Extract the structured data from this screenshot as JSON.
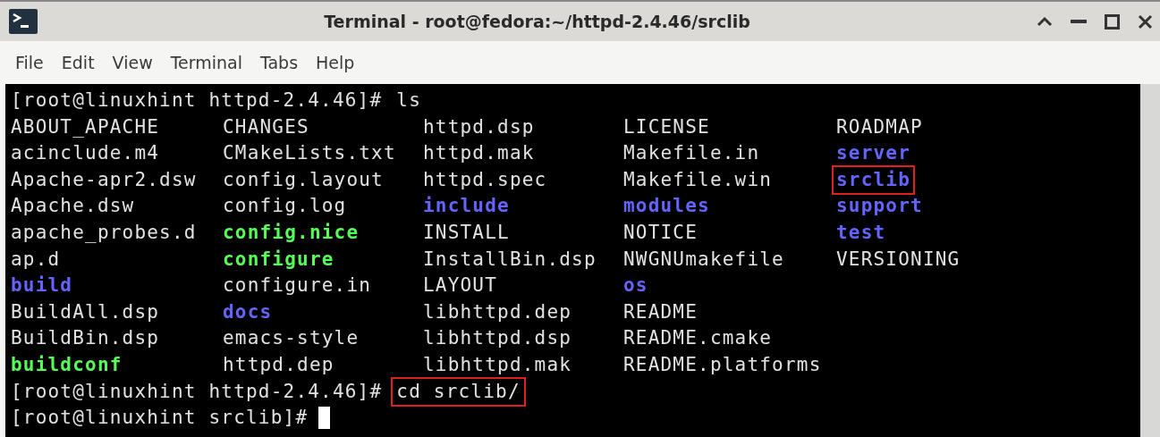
{
  "window": {
    "title": "Terminal - root@fedora:~/httpd-2.4.46/srclib"
  },
  "menu": [
    "File",
    "Edit",
    "View",
    "Terminal",
    "Tabs",
    "Help"
  ],
  "terminal": [
    {
      "kind": "prompt",
      "prompt": "[root@linuxhint httpd-2.4.46]#",
      "command": "ls",
      "highlighted": false
    },
    {
      "kind": "listing",
      "rows": [
        [
          {
            "name": "ABOUT_APACHE",
            "kind": "file",
            "highlighted": false
          },
          {
            "name": "CHANGES",
            "kind": "file",
            "highlighted": false
          },
          {
            "name": "httpd.dsp",
            "kind": "file",
            "highlighted": false
          },
          {
            "name": "LICENSE",
            "kind": "file",
            "highlighted": false
          },
          {
            "name": "ROADMAP",
            "kind": "file",
            "highlighted": false
          }
        ],
        [
          {
            "name": "acinclude.m4",
            "kind": "file",
            "highlighted": false
          },
          {
            "name": "CMakeLists.txt",
            "kind": "file",
            "highlighted": false
          },
          {
            "name": "httpd.mak",
            "kind": "file",
            "highlighted": false
          },
          {
            "name": "Makefile.in",
            "kind": "file",
            "highlighted": false
          },
          {
            "name": "server",
            "kind": "dir",
            "highlighted": false
          }
        ],
        [
          {
            "name": "Apache-apr2.dsw",
            "kind": "file",
            "highlighted": false
          },
          {
            "name": "config.layout",
            "kind": "file",
            "highlighted": false
          },
          {
            "name": "httpd.spec",
            "kind": "file",
            "highlighted": false
          },
          {
            "name": "Makefile.win",
            "kind": "file",
            "highlighted": false
          },
          {
            "name": "srclib",
            "kind": "dir",
            "highlighted": true
          }
        ],
        [
          {
            "name": "Apache.dsw",
            "kind": "file",
            "highlighted": false
          },
          {
            "name": "config.log",
            "kind": "file",
            "highlighted": false
          },
          {
            "name": "include",
            "kind": "dir",
            "highlighted": false
          },
          {
            "name": "modules",
            "kind": "dir",
            "highlighted": false
          },
          {
            "name": "support",
            "kind": "dir",
            "highlighted": false
          }
        ],
        [
          {
            "name": "apache_probes.d",
            "kind": "file",
            "highlighted": false
          },
          {
            "name": "config.nice",
            "kind": "exec",
            "highlighted": false
          },
          {
            "name": "INSTALL",
            "kind": "file",
            "highlighted": false
          },
          {
            "name": "NOTICE",
            "kind": "file",
            "highlighted": false
          },
          {
            "name": "test",
            "kind": "dir",
            "highlighted": false
          }
        ],
        [
          {
            "name": "ap.d",
            "kind": "file",
            "highlighted": false
          },
          {
            "name": "configure",
            "kind": "exec",
            "highlighted": false
          },
          {
            "name": "InstallBin.dsp",
            "kind": "file",
            "highlighted": false
          },
          {
            "name": "NWGNUmakefile",
            "kind": "file",
            "highlighted": false
          },
          {
            "name": "VERSIONING",
            "kind": "file",
            "highlighted": false
          }
        ],
        [
          {
            "name": "build",
            "kind": "dir",
            "highlighted": false
          },
          {
            "name": "configure.in",
            "kind": "file",
            "highlighted": false
          },
          {
            "name": "LAYOUT",
            "kind": "file",
            "highlighted": false
          },
          {
            "name": "os",
            "kind": "dir",
            "highlighted": false
          }
        ],
        [
          {
            "name": "BuildAll.dsp",
            "kind": "file",
            "highlighted": false
          },
          {
            "name": "docs",
            "kind": "dir",
            "highlighted": false
          },
          {
            "name": "libhttpd.dep",
            "kind": "file",
            "highlighted": false
          },
          {
            "name": "README",
            "kind": "file",
            "highlighted": false
          }
        ],
        [
          {
            "name": "BuildBin.dsp",
            "kind": "file",
            "highlighted": false
          },
          {
            "name": "emacs-style",
            "kind": "file",
            "highlighted": false
          },
          {
            "name": "libhttpd.dsp",
            "kind": "file",
            "highlighted": false
          },
          {
            "name": "README.cmake",
            "kind": "file",
            "highlighted": false
          }
        ],
        [
          {
            "name": "buildconf",
            "kind": "exec",
            "highlighted": false
          },
          {
            "name": "httpd.dep",
            "kind": "file",
            "highlighted": false
          },
          {
            "name": "libhttpd.mak",
            "kind": "file",
            "highlighted": false
          },
          {
            "name": "README.platforms",
            "kind": "file",
            "highlighted": false
          }
        ]
      ]
    },
    {
      "kind": "prompt",
      "prompt": "[root@linuxhint httpd-2.4.46]#",
      "command": "cd srclib/",
      "highlighted": true
    },
    {
      "kind": "input",
      "prompt": "[root@linuxhint srclib]#",
      "cursor": true
    }
  ]
}
